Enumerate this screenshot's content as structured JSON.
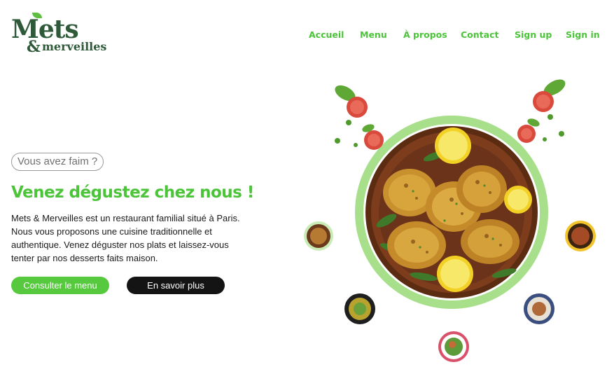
{
  "brand": {
    "logo_line1": "Mets",
    "logo_amp": "&",
    "logo_line2": "merveilles"
  },
  "nav": {
    "items": [
      {
        "label": "Accueil"
      },
      {
        "label": "Menu"
      },
      {
        "label": "À propos"
      },
      {
        "label": "Contact"
      },
      {
        "label": "Sign up"
      },
      {
        "label": "Sign in"
      }
    ]
  },
  "hero": {
    "pill": "Vous avez faim ?",
    "headline": "Venez dégustez chez nous !",
    "description": "Mets & Merveilles est un restaurant familial situé à Paris. Nous vous proposons une cuisine traditionnelle et authentique. Venez déguster nos plats et laissez-vous tenter par nos desserts faits maison.",
    "primary_button": "Consulter le menu",
    "secondary_button": "En savoir plus"
  },
  "colors": {
    "accent": "#4cc43a",
    "brand_dark": "#2f5a3a",
    "button_dark": "#141414",
    "ring": "#a7df8a"
  },
  "images": {
    "main_dish": "roasted-chicken-plate-image",
    "side_dishes": [
      "pasta-dish-icon",
      "salad-dish-icon",
      "rice-dish-icon",
      "spice-dish-icon",
      "veggie-dish-icon"
    ]
  }
}
